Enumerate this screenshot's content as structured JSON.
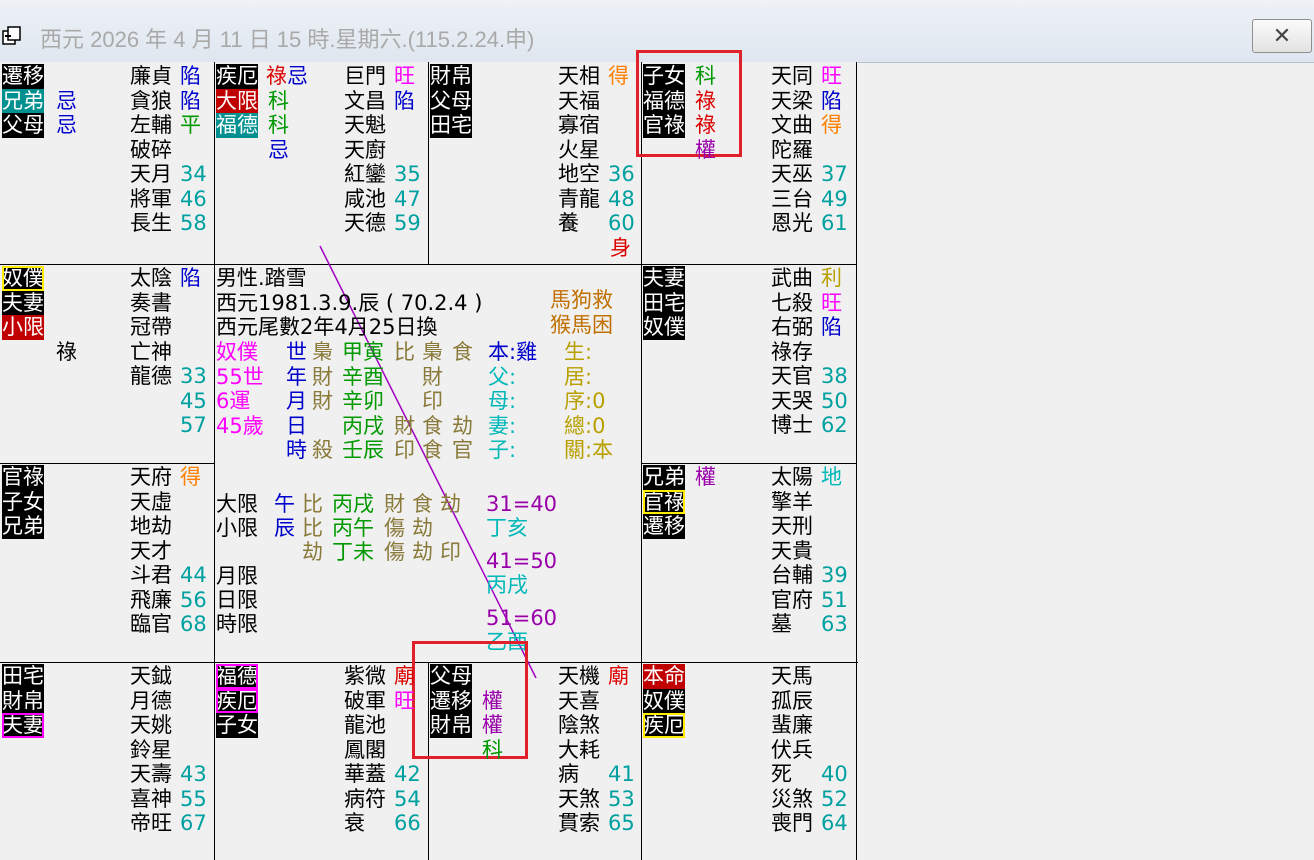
{
  "window": {
    "title": "西元 2026 年 4 月 11 日 15 時.星期六.(115.2.24.申)",
    "close_label": "✕"
  },
  "colors": {
    "black": "#000000",
    "white": "#ffffff",
    "blue": "#0000cc",
    "magenta": "#ff00ff",
    "red": "#dd0000",
    "green": "#009900",
    "orange": "#ff8000",
    "teal": "#00a0a0",
    "olive": "#8a7a3a",
    "gold": "#b8a000",
    "purple": "#9900aa",
    "cyan": "#00b8b8"
  },
  "palaces": [
    {
      "id": "p1",
      "labels": [
        {
          "t": "遷移",
          "s": "inv"
        },
        {
          "t": "兄弟",
          "s": "teal"
        },
        {
          "t": "父母",
          "s": "inv"
        }
      ],
      "transforms": [
        {
          "t": "",
          "c": "blue"
        },
        {
          "t": "忌",
          "c": "blue"
        },
        {
          "t": "忌",
          "c": "blue"
        }
      ],
      "stars": [
        {
          "n": "廉貞",
          "m": "陷",
          "mc": "blue"
        },
        {
          "n": "貪狼",
          "m": "陷",
          "mc": "blue"
        },
        {
          "n": "左輔",
          "m": "平",
          "mc": "green"
        },
        {
          "n": "破碎",
          "m": "",
          "mc": "black"
        },
        {
          "n": "天月",
          "m": "34",
          "mc": "teal"
        },
        {
          "n": "將軍",
          "m": "46",
          "mc": "teal"
        },
        {
          "n": "長生",
          "m": "58",
          "mc": "teal"
        }
      ],
      "extra": ""
    },
    {
      "id": "p2",
      "labels": [
        {
          "t": "疾厄",
          "s": "inv"
        },
        {
          "t": "大限",
          "s": "red"
        },
        {
          "t": "福德",
          "s": "teal"
        }
      ],
      "transforms": [
        {
          "t": "祿忌",
          "c": "mixed1"
        },
        {
          "t": "科",
          "c": "green"
        },
        {
          "t": "科",
          "c": "green"
        },
        {
          "t": "忌",
          "c": "blue"
        }
      ],
      "stars": [
        {
          "n": "巨門",
          "m": "旺",
          "mc": "magenta"
        },
        {
          "n": "文昌",
          "m": "陷",
          "mc": "blue"
        },
        {
          "n": "天魁",
          "m": "",
          "mc": "black"
        },
        {
          "n": "天廚",
          "m": "",
          "mc": "black"
        },
        {
          "n": "紅鑾",
          "m": "35",
          "mc": "teal"
        },
        {
          "n": "咸池",
          "m": "47",
          "mc": "teal"
        },
        {
          "n": "天德",
          "m": "59",
          "mc": "teal"
        }
      ],
      "extra": ""
    },
    {
      "id": "p3",
      "labels": [
        {
          "t": "財帛",
          "s": "inv"
        },
        {
          "t": "父母",
          "s": "inv"
        },
        {
          "t": "田宅",
          "s": "inv"
        }
      ],
      "transforms": [],
      "stars": [
        {
          "n": "天相",
          "m": "得",
          "mc": "orange"
        },
        {
          "n": "天福",
          "m": "",
          "mc": "black"
        },
        {
          "n": "寡宿",
          "m": "",
          "mc": "black"
        },
        {
          "n": "火星",
          "m": "",
          "mc": "black"
        },
        {
          "n": "地空",
          "m": "36",
          "mc": "teal"
        },
        {
          "n": "青龍",
          "m": "48",
          "mc": "teal"
        },
        {
          "n": "養",
          "m": "60",
          "mc": "teal"
        }
      ],
      "extra": "身"
    },
    {
      "id": "p4",
      "labels": [
        {
          "t": "子女",
          "s": "inv"
        },
        {
          "t": "福德",
          "s": "inv"
        },
        {
          "t": "官祿",
          "s": "inv"
        }
      ],
      "transforms": [
        {
          "t": "科",
          "c": "green"
        },
        {
          "t": "祿",
          "c": "red"
        },
        {
          "t": "祿",
          "c": "red"
        },
        {
          "t": "權",
          "c": "purple"
        }
      ],
      "stars": [
        {
          "n": "天同",
          "m": "旺",
          "mc": "magenta"
        },
        {
          "n": "天梁",
          "m": "陷",
          "mc": "blue"
        },
        {
          "n": "文曲",
          "m": "得",
          "mc": "orange"
        },
        {
          "n": "陀羅",
          "m": "",
          "mc": "black"
        },
        {
          "n": "天巫",
          "m": "37",
          "mc": "teal"
        },
        {
          "n": "三台",
          "m": "49",
          "mc": "teal"
        },
        {
          "n": "恩光",
          "m": "61",
          "mc": "teal"
        }
      ],
      "extra": ""
    },
    {
      "id": "p5",
      "labels": [
        {
          "t": "奴僕",
          "s": "yellow"
        },
        {
          "t": "夫妻",
          "s": "inv"
        },
        {
          "t": "小限",
          "s": "red"
        }
      ],
      "transforms": [
        {
          "t": "",
          "c": "black"
        },
        {
          "t": "",
          "c": "black"
        },
        {
          "t": "",
          "c": "black"
        },
        {
          "t": "祿",
          "c": "black"
        }
      ],
      "stars": [
        {
          "n": "太陰",
          "m": "陷",
          "mc": "blue"
        },
        {
          "n": "奏書",
          "m": "",
          "mc": "black"
        },
        {
          "n": "冠帶",
          "m": "",
          "mc": "black"
        },
        {
          "n": "亡神",
          "m": "",
          "mc": "black"
        },
        {
          "n": "龍德",
          "m": "33",
          "mc": "teal"
        },
        {
          "n": "",
          "m": "45",
          "mc": "teal"
        },
        {
          "n": "",
          "m": "57",
          "mc": "teal"
        }
      ],
      "extra": ""
    },
    {
      "id": "p6",
      "labels": [
        {
          "t": "夫妻",
          "s": "inv"
        },
        {
          "t": "田宅",
          "s": "inv"
        },
        {
          "t": "奴僕",
          "s": "inv"
        }
      ],
      "transforms": [],
      "stars": [
        {
          "n": "武曲",
          "m": "利",
          "mc": "gold"
        },
        {
          "n": "七殺",
          "m": "旺",
          "mc": "magenta"
        },
        {
          "n": "右弼",
          "m": "陷",
          "mc": "blue"
        },
        {
          "n": "祿存",
          "m": "",
          "mc": "black"
        },
        {
          "n": "天官",
          "m": "38",
          "mc": "teal"
        },
        {
          "n": "天哭",
          "m": "50",
          "mc": "teal"
        },
        {
          "n": "博士",
          "m": "62",
          "mc": "teal"
        }
      ],
      "extra": ""
    },
    {
      "id": "p7",
      "labels": [
        {
          "t": "官祿",
          "s": "inv"
        },
        {
          "t": "子女",
          "s": "inv"
        },
        {
          "t": "兄弟",
          "s": "inv"
        }
      ],
      "transforms": [],
      "stars": [
        {
          "n": "天府",
          "m": "得",
          "mc": "orange"
        },
        {
          "n": "天虛",
          "m": "",
          "mc": "black"
        },
        {
          "n": "地劫",
          "m": "",
          "mc": "black"
        },
        {
          "n": "天才",
          "m": "",
          "mc": "black"
        },
        {
          "n": "斗君",
          "m": "44",
          "mc": "teal"
        },
        {
          "n": "飛廉",
          "m": "56",
          "mc": "teal"
        },
        {
          "n": "臨官",
          "m": "68",
          "mc": "teal"
        }
      ],
      "extra": ""
    },
    {
      "id": "p8",
      "labels": [
        {
          "t": "兄弟",
          "s": "inv"
        },
        {
          "t": "官祿",
          "s": "yellow"
        },
        {
          "t": "遷移",
          "s": "inv"
        }
      ],
      "transforms": [
        {
          "t": "權",
          "c": "purple"
        }
      ],
      "stars": [
        {
          "n": "太陽",
          "m": "地",
          "mc": "cyan"
        },
        {
          "n": "擎羊",
          "m": "",
          "mc": "black"
        },
        {
          "n": "天刑",
          "m": "",
          "mc": "black"
        },
        {
          "n": "天貴",
          "m": "",
          "mc": "black"
        },
        {
          "n": "台輔",
          "m": "39",
          "mc": "teal"
        },
        {
          "n": "官府",
          "m": "51",
          "mc": "teal"
        },
        {
          "n": "墓",
          "m": "63",
          "mc": "teal"
        }
      ],
      "extra": ""
    },
    {
      "id": "p9",
      "labels": [
        {
          "t": "田宅",
          "s": "inv"
        },
        {
          "t": "財帛",
          "s": "inv"
        },
        {
          "t": "夫妻",
          "s": "magenta"
        }
      ],
      "transforms": [],
      "stars": [
        {
          "n": "天鉞",
          "m": "",
          "mc": "black"
        },
        {
          "n": "月德",
          "m": "",
          "mc": "black"
        },
        {
          "n": "天姚",
          "m": "",
          "mc": "black"
        },
        {
          "n": "鈴星",
          "m": "",
          "mc": "black"
        },
        {
          "n": "天壽",
          "m": "43",
          "mc": "teal"
        },
        {
          "n": "喜神",
          "m": "55",
          "mc": "teal"
        },
        {
          "n": "帝旺",
          "m": "67",
          "mc": "teal"
        }
      ],
      "extra": ""
    },
    {
      "id": "p10",
      "labels": [
        {
          "t": "福德",
          "s": "magenta"
        },
        {
          "t": "疾厄",
          "s": "magenta"
        },
        {
          "t": "子女",
          "s": "inv"
        }
      ],
      "transforms": [],
      "stars": [
        {
          "n": "紫微",
          "m": "廟",
          "mc": "red"
        },
        {
          "n": "破軍",
          "m": "旺",
          "mc": "magenta"
        },
        {
          "n": "龍池",
          "m": "",
          "mc": "black"
        },
        {
          "n": "鳳閣",
          "m": "",
          "mc": "black"
        },
        {
          "n": "華蓋",
          "m": "42",
          "mc": "teal"
        },
        {
          "n": "病符",
          "m": "54",
          "mc": "teal"
        },
        {
          "n": "衰",
          "m": "66",
          "mc": "teal"
        }
      ],
      "extra": ""
    },
    {
      "id": "p11",
      "labels": [
        {
          "t": "父母",
          "s": "inv"
        },
        {
          "t": "遷移",
          "s": "inv"
        },
        {
          "t": "財帛",
          "s": "inv"
        }
      ],
      "transforms": [
        {
          "t": "",
          "c": "black"
        },
        {
          "t": "權",
          "c": "purple"
        },
        {
          "t": "權",
          "c": "purple"
        },
        {
          "t": "科",
          "c": "green"
        }
      ],
      "stars": [
        {
          "n": "天機",
          "m": "廟",
          "mc": "red"
        },
        {
          "n": "天喜",
          "m": "",
          "mc": "black"
        },
        {
          "n": "陰煞",
          "m": "",
          "mc": "black"
        },
        {
          "n": "大耗",
          "m": "",
          "mc": "black"
        },
        {
          "n": "病",
          "m": "41",
          "mc": "teal"
        },
        {
          "n": "天煞",
          "m": "53",
          "mc": "teal"
        },
        {
          "n": "貫索",
          "m": "65",
          "mc": "teal"
        }
      ],
      "extra": ""
    },
    {
      "id": "p12",
      "labels": [
        {
          "t": "本命",
          "s": "red"
        },
        {
          "t": "奴僕",
          "s": "inv"
        },
        {
          "t": "疾厄",
          "s": "yellow"
        }
      ],
      "transforms": [],
      "stars": [
        {
          "n": "天馬",
          "m": "",
          "mc": "black"
        },
        {
          "n": "孤辰",
          "m": "",
          "mc": "black"
        },
        {
          "n": "蜚廉",
          "m": "",
          "mc": "black"
        },
        {
          "n": "伏兵",
          "m": "",
          "mc": "black"
        },
        {
          "n": "死",
          "m": "40",
          "mc": "teal"
        },
        {
          "n": "災煞",
          "m": "52",
          "mc": "teal"
        },
        {
          "n": "喪門",
          "m": "64",
          "mc": "teal"
        }
      ],
      "extra": ""
    }
  ],
  "center": {
    "gender_name": "男性.踏雪",
    "birth": "西元1981.3.9.辰 ( 70.2.4 )",
    "lunar": "西元尾數2年4月25日換",
    "stars_top": "馬狗救",
    "stars_bottom": "猴馬困",
    "pillars": [
      {
        "a": "奴僕",
        "b": "世",
        "c": "梟",
        "d": "甲寅",
        "e": "比",
        "f": "梟",
        "g": "食",
        "h": "本:雞",
        "i": "生:"
      },
      {
        "a": "55世",
        "b": "年",
        "c": "財",
        "d": "辛酉",
        "e": "",
        "f": "財",
        "g": "",
        "h": "父:",
        "i": "居:"
      },
      {
        "a": "6運",
        "b": "月",
        "c": "財",
        "d": "辛卯",
        "e": "",
        "f": "印",
        "g": "",
        "h": "母:",
        "i": "序:0"
      },
      {
        "a": "45歲",
        "b": "日",
        "c": "",
        "d": "丙戌",
        "e": "財",
        "f": "食",
        "g": "劫",
        "h": "妻:",
        "i": "總:0"
      },
      {
        "a": "",
        "b": "時",
        "c": "殺",
        "d": "壬辰",
        "e": "印",
        "f": "食",
        "g": "官",
        "h": "子:",
        "i": "關:本"
      }
    ],
    "daxian": {
      "l": "大限",
      "b": "午",
      "c": "比",
      "d": "丙戌",
      "e": "財",
      "f": "食",
      "g": "劫"
    },
    "xiaoxian": {
      "l": "小限",
      "b": "辰",
      "c": "比",
      "d": "丙午",
      "e": "傷",
      "f": "劫",
      "g": ""
    },
    "third": {
      "c": "劫",
      "d": "丁未",
      "e": "傷",
      "f": "劫",
      "g": "印"
    },
    "month_limit": "月限",
    "day_limit": "日限",
    "hour_limit": "時限",
    "ranges": [
      {
        "r": "31=40",
        "s": "丁亥"
      },
      {
        "r": "41=50",
        "s": "丙戌"
      },
      {
        "r": "51=60",
        "s": "乙酉"
      }
    ]
  }
}
